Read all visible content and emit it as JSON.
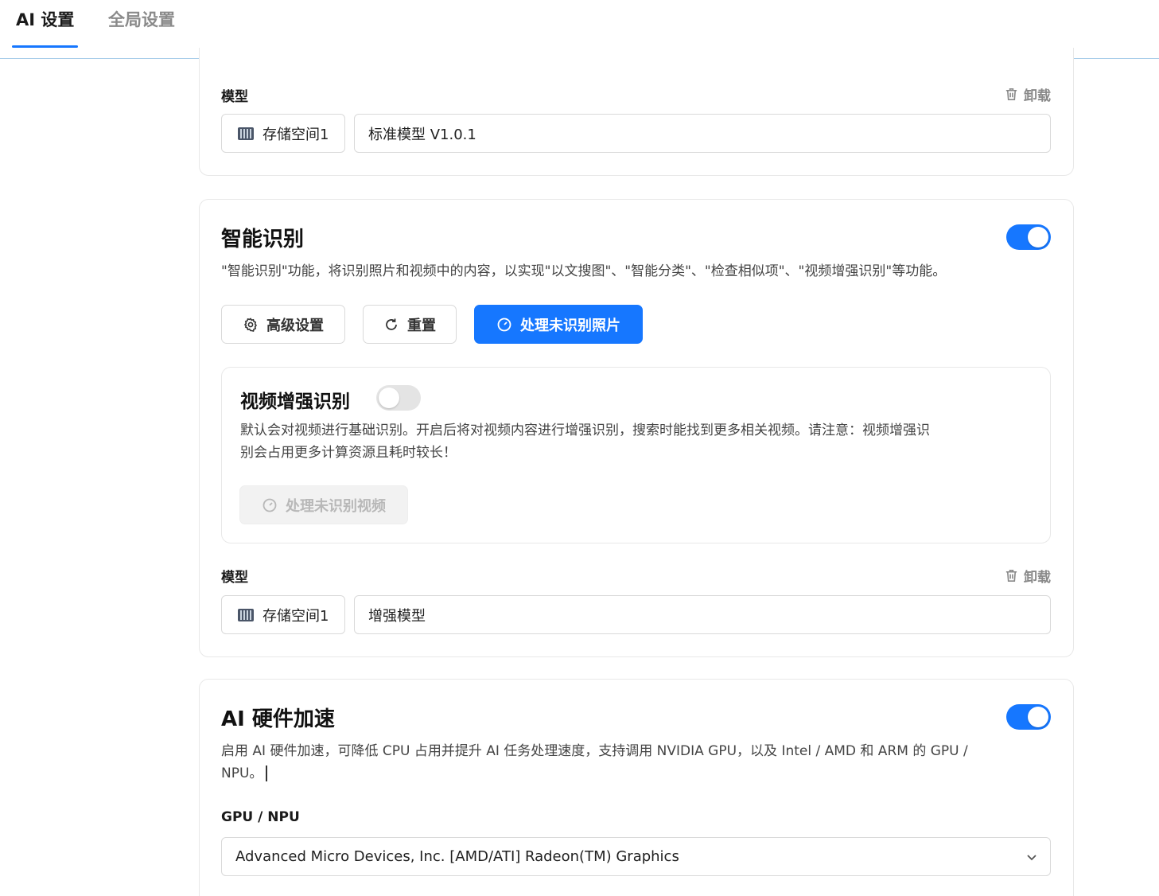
{
  "tabs": [
    {
      "label": "AI 设置",
      "active": true
    },
    {
      "label": "全局设置",
      "active": false
    }
  ],
  "model_top": {
    "label": "模型",
    "unload_label": "卸载",
    "storage_label": "存储空间1",
    "model_value": "标准模型 V1.0.1"
  },
  "smart_recognition": {
    "title": "智能识别",
    "enabled": true,
    "description": "\"智能识别\"功能，将识别照片和视频中的内容，以实现\"以文搜图\"、\"智能分类\"、\"检查相似项\"、\"视频增强识别\"等功能。",
    "buttons": {
      "advanced": "高级设置",
      "reset": "重置",
      "process_photos": "处理未识别照片"
    },
    "video_enhance": {
      "title": "视频增强识别",
      "enabled": false,
      "description_line1": "默认会对视频进行基础识别。开启后将对视频内容进行增强识别，搜索时能找到更多相关视频。请注意：视频增强识",
      "description_line2": "别会占用更多计算资源且耗时较长！",
      "process_videos": "处理未识别视频"
    },
    "model": {
      "label": "模型",
      "unload_label": "卸载",
      "storage_label": "存储空间1",
      "model_value": "增强模型"
    }
  },
  "hw_accel": {
    "title": "AI 硬件加速",
    "enabled": true,
    "description_line1": "启用 AI 硬件加速，可降低 CPU 占用并提升 AI 任务处理速度，支持调用 NVIDIA GPU，以及 Intel / AMD 和 ARM 的 GPU /",
    "description_line2": "NPU。",
    "gpu_label": "GPU / NPU",
    "gpu_selected": "Advanced Micro Devices, Inc. [AMD/ATI] Radeon(TM) Graphics"
  },
  "colors": {
    "accent": "#1677ff",
    "border": "#d9d9d9"
  }
}
